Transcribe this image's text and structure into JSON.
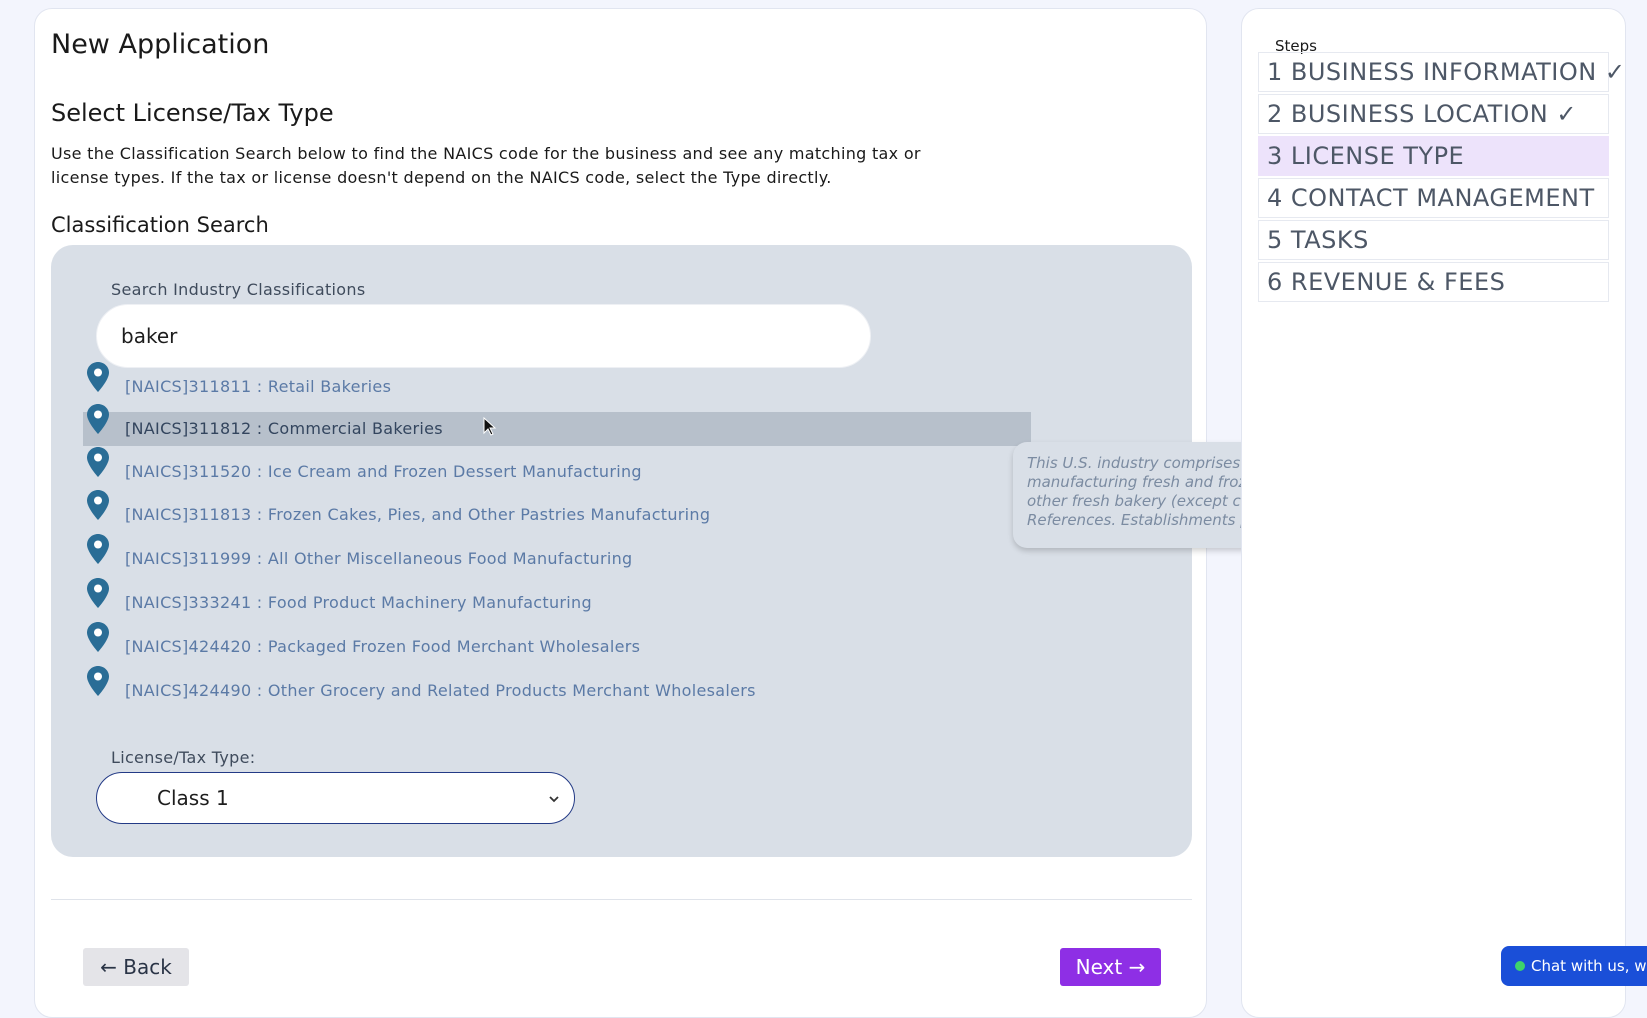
{
  "page": {
    "title": "New Application",
    "section_title": "Select License/Tax Type",
    "intro": "Use the Classification Search below to find the NAICS code for the business and see any matching tax or license types. If the tax or license doesn't depend on the NAICS code, select the Type directly.",
    "classification_heading": "Classification Search"
  },
  "search": {
    "label": "Search Industry Classifications",
    "value": "baker",
    "results": [
      {
        "text": "[NAICS]311811 : Retail Bakeries"
      },
      {
        "text": "[NAICS]311812 : Commercial Bakeries"
      },
      {
        "text": "[NAICS]311520 : Ice Cream and Frozen Dessert Manufacturing"
      },
      {
        "text": "[NAICS]311813 : Frozen Cakes, Pies, and Other Pastries Manufacturing"
      },
      {
        "text": "[NAICS]311999 : All Other Miscellaneous Food Manufacturing"
      },
      {
        "text": "[NAICS]333241 : Food Product Machinery Manufacturing"
      },
      {
        "text": "[NAICS]424420 : Packaged Frozen Food Merchant Wholesalers"
      },
      {
        "text": "[NAICS]424490 : Other Grocery and Related Products Merchant Wholesalers"
      }
    ],
    "hovered_index": 1,
    "tooltip": "This U.S. industry comprises establishments primarily engaged in manufacturing fresh and frozen bread and bread-type rolls and other fresh bakery (except cookies and crackers) products. Cross-References. Establishments primarily engaged in--"
  },
  "license_type": {
    "label": "License/Tax Type:",
    "selected": "Class 1"
  },
  "nav": {
    "back_label": "← Back",
    "next_label": "Next →"
  },
  "steps": {
    "title": "Steps",
    "items": [
      {
        "label": "1 BUSINESS INFORMATION ✓"
      },
      {
        "label": "2 BUSINESS LOCATION ✓"
      },
      {
        "label": "3 LICENSE TYPE"
      },
      {
        "label": "4 CONTACT MANAGEMENT"
      },
      {
        "label": "5 TASKS"
      },
      {
        "label": "6 REVENUE & FEES"
      }
    ],
    "active_index": 2
  },
  "chat": {
    "label": "Chat with us, we a"
  },
  "colors": {
    "accent": "#8e2fe5",
    "panel": "#d9dfe7",
    "pin": "#2a6d96",
    "active_step": "#ede3fb"
  },
  "icons": {
    "result_pin": "location-pin-icon",
    "select_arrow": "chevron-down-icon"
  }
}
